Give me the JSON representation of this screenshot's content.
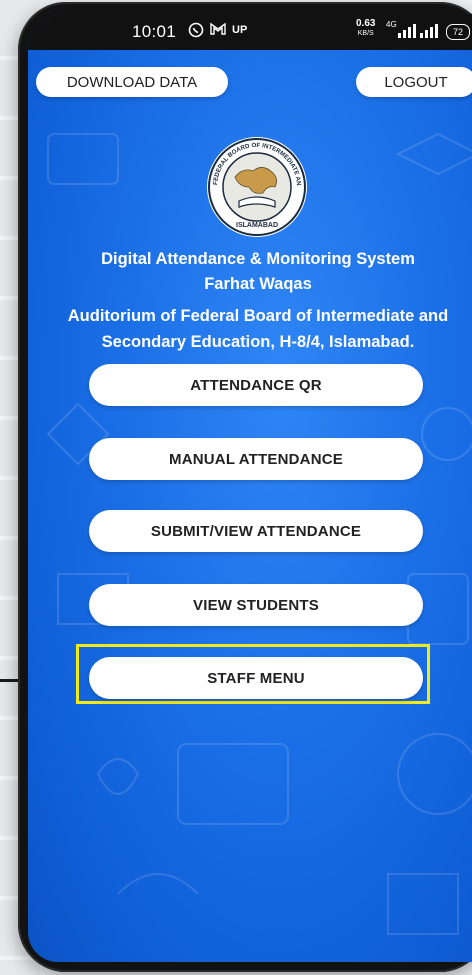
{
  "status_bar": {
    "time": "10:01",
    "icons": [
      "whatsapp-icon",
      "gmail-icon",
      "upload-indicator-icon"
    ],
    "upload_label": "UP",
    "net_speed_value": "0.63",
    "net_speed_unit": "KB/S",
    "network_type": "4G",
    "battery": "72"
  },
  "header_buttons": {
    "download_label": "DOWNLOAD DATA",
    "logout_label": "LOGOUT"
  },
  "logo": {
    "ring_text": "FEDERAL BOARD OF INTERMEDIATE AND SECONDARY EDUCATION",
    "bottom_text": "ISLAMABAD"
  },
  "info": {
    "system_name": "Digital Attendance & Monitoring System",
    "user_name": "Farhat Waqas",
    "venue_line1": "Auditorium of Federal Board of Intermediate and",
    "venue_line2": "Secondary Education, H-8/4, Islamabad."
  },
  "menu": [
    {
      "label": "ATTENDANCE QR"
    },
    {
      "label": "MANUAL ATTENDANCE"
    },
    {
      "label": "SUBMIT/VIEW ATTENDANCE"
    },
    {
      "label": "VIEW STUDENTS"
    },
    {
      "label": "STAFF MENU"
    }
  ],
  "colors": {
    "background_blue": "#1b6fe6",
    "button_bg": "#ffffff",
    "highlight": "#f2ea18"
  }
}
